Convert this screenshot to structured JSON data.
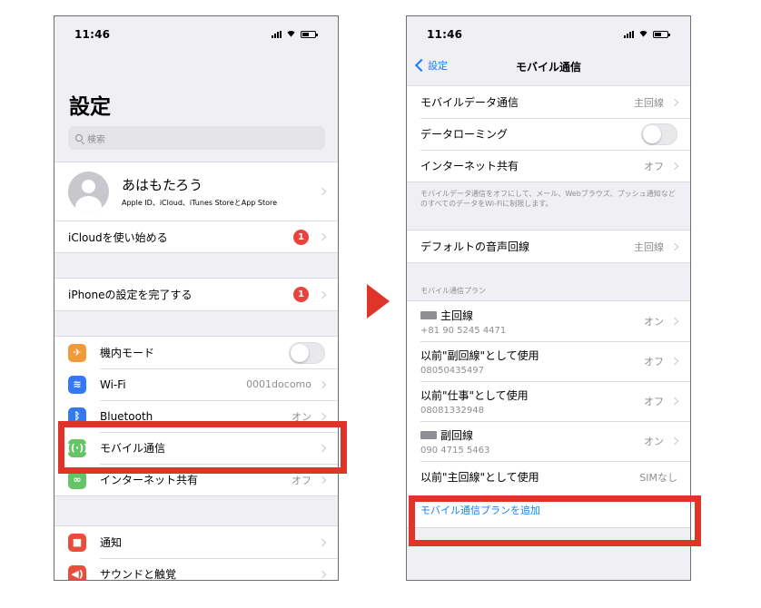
{
  "status": {
    "time": "11:46"
  },
  "left": {
    "title": "設定",
    "search_placeholder": "検索",
    "profile": {
      "name": "あはもたろう",
      "subtitle": "Apple ID、iCloud、iTunes StoreとApp Store"
    },
    "icloud_row": {
      "label": "iCloudを使い始める",
      "badge": "1"
    },
    "setup_row": {
      "label": "iPhoneの設定を完了する",
      "badge": "1"
    },
    "items": [
      {
        "label": "機内モード",
        "icon": "airplane-icon",
        "color": "#f19a37"
      },
      {
        "label": "Wi-Fi",
        "value": "0001docomo",
        "icon": "wifi-icon",
        "color": "#3478f6"
      },
      {
        "label": "Bluetooth",
        "value": "オン",
        "icon": "bluetooth-icon",
        "color": "#3478f6"
      },
      {
        "label": "モバイル通信",
        "icon": "antenna-icon",
        "color": "#65c466"
      },
      {
        "label": "インターネット共有",
        "value": "オフ",
        "icon": "hotspot-icon",
        "color": "#65c466"
      }
    ],
    "items2": [
      {
        "label": "通知",
        "icon": "notification-icon",
        "color": "#eb4d3d"
      },
      {
        "label": "サウンドと触覚",
        "icon": "sound-icon",
        "color": "#eb4d3d"
      }
    ]
  },
  "right": {
    "back_label": "設定",
    "title": "モバイル通信",
    "rows": [
      {
        "label": "モバイルデータ通信",
        "value": "主回線"
      },
      {
        "label": "データローミング"
      },
      {
        "label": "インターネット共有",
        "value": "オフ"
      }
    ],
    "footer": "モバイルデータ通信をオフにして、メール、Webブラウズ、プッシュ通知などのすべてのデータをWi-Fiに制限します。",
    "voice_row": {
      "label": "デフォルトの音声回線",
      "value": "主回線"
    },
    "plans_header": "モバイル通信プラン",
    "plans": [
      {
        "title": "主回線",
        "number": "+81 90 5245 4471",
        "value": "オン",
        "sim": true
      },
      {
        "title": "以前\"副回線\"として使用",
        "number": "08050435497",
        "value": "オフ"
      },
      {
        "title": "以前\"仕事\"として使用",
        "number": "08081332948",
        "value": "オフ"
      },
      {
        "title": "副回線",
        "number": "090 4715 5463",
        "value": "オン",
        "sim": true
      }
    ],
    "last_plan": {
      "title": "以前\"主回線\"として使用",
      "value": "SIMなし"
    },
    "add_plan": "モバイル通信プランを追加"
  },
  "colors": {
    "highlight": "#e0332a",
    "link": "#1a7ef0",
    "badge": "#e8433d"
  }
}
